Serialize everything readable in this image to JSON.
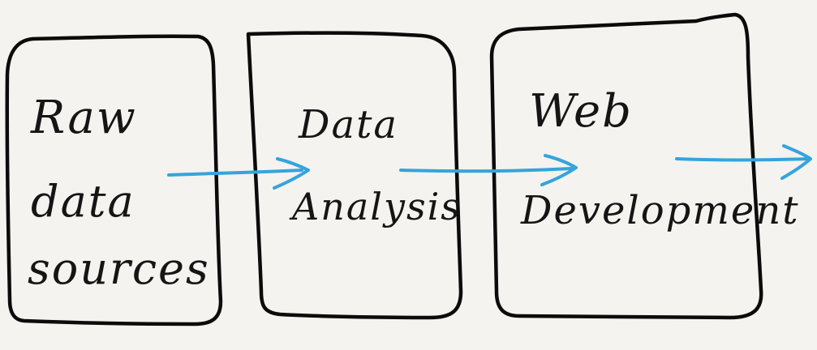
{
  "diagram": {
    "nodes": [
      {
        "id": "raw-data-sources",
        "lines": [
          "Raw",
          "data",
          "sources"
        ]
      },
      {
        "id": "data-analysis",
        "lines": [
          "Data",
          "Analysis"
        ]
      },
      {
        "id": "web-development",
        "lines": [
          "Web",
          "Development"
        ]
      }
    ],
    "edges": [
      {
        "from": "raw-data-sources",
        "to": "data-analysis"
      },
      {
        "from": "data-analysis",
        "to": "web-development"
      },
      {
        "from": "web-development",
        "to": ""
      }
    ],
    "colors": {
      "box_stroke": "#0b0b0b",
      "arrow": "#35a4dc",
      "background": "#f4f3ef",
      "text": "#151515"
    }
  }
}
